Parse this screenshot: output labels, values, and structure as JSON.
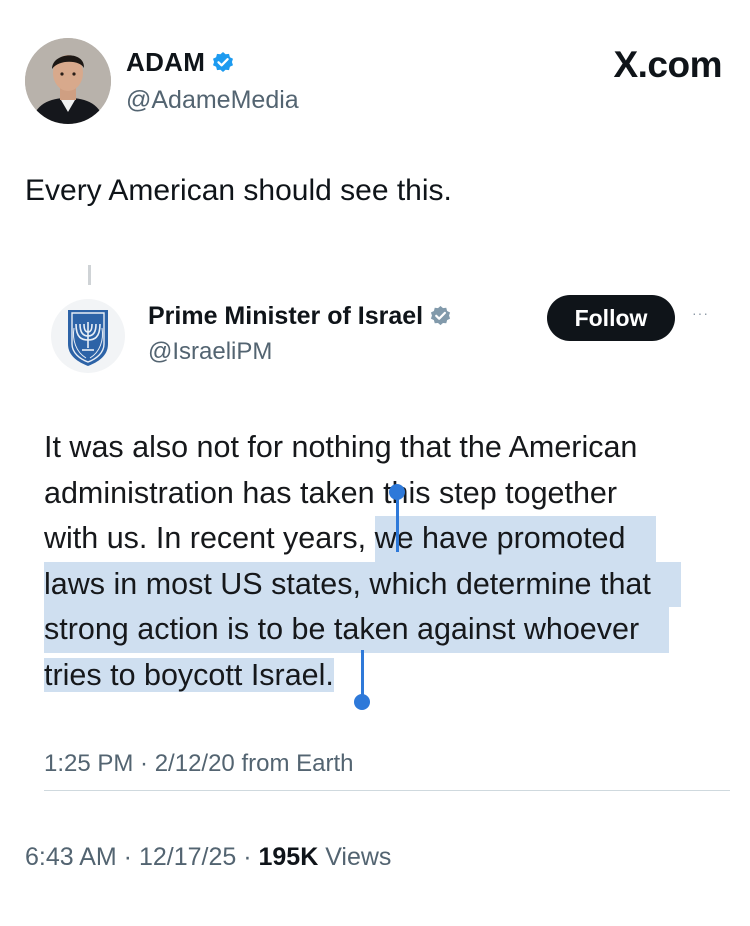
{
  "post": {
    "author_name": "ADAM",
    "author_handle": "@AdameMedia",
    "brand": "X.com",
    "text": "Every American should see this."
  },
  "quoted_tweet": {
    "name": "Prime Minister of Israel",
    "handle": "@IsraeliPM",
    "follow_label": "Follow",
    "more_label": "···",
    "lines": [
      "It was also not for nothing that the American",
      "administration has taken this step together",
      "with us. In recent years, ",
      "we have promoted",
      "laws in most US states, which determine that",
      "strong action is to be taken against whoever",
      "tries to boycott Israel."
    ],
    "meta": "1:25 PM · 2/12/20 from Earth",
    "selection_color": "#cfdff0",
    "handle_color": "#2e79d9"
  },
  "footer": {
    "time": "6:43 AM · 12/17/25 · ",
    "views_count": "195K",
    "views_label": " Views"
  },
  "colors": {
    "verified": "#1d9bf0",
    "verified_gray": "#829aab",
    "text": "#0f1419",
    "secondary": "#536471"
  }
}
